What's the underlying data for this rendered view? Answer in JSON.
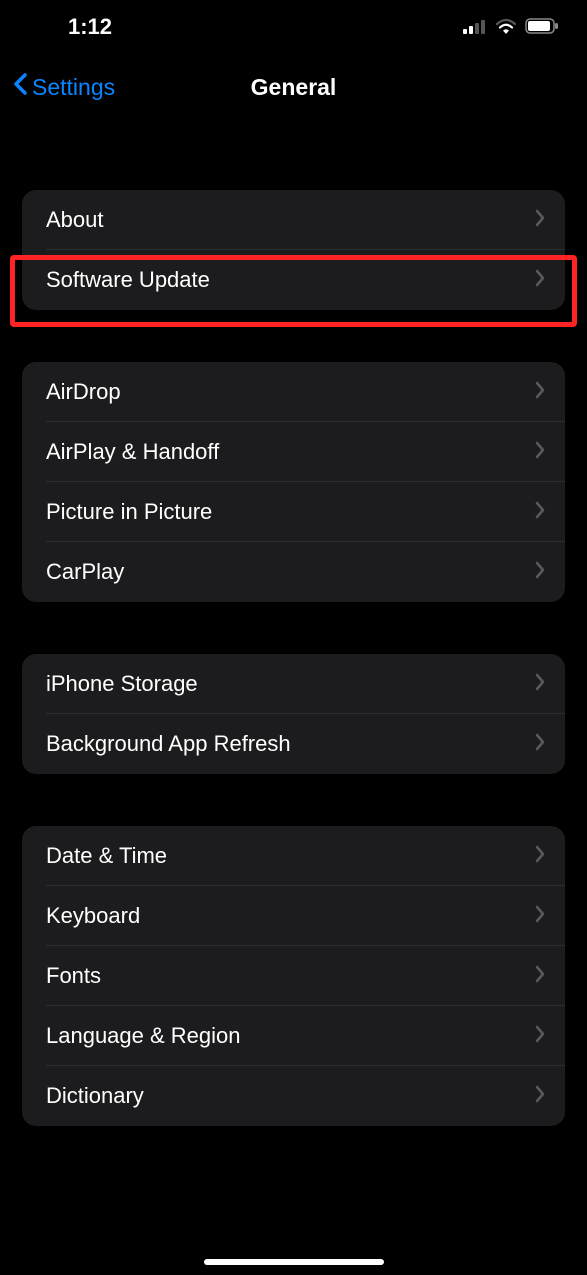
{
  "status": {
    "time": "1:12"
  },
  "nav": {
    "back_label": "Settings",
    "title": "General"
  },
  "groups": [
    {
      "rows": [
        {
          "label": "About",
          "name": "row-about"
        },
        {
          "label": "Software Update",
          "name": "row-software-update",
          "highlighted": true
        }
      ]
    },
    {
      "rows": [
        {
          "label": "AirDrop",
          "name": "row-airdrop"
        },
        {
          "label": "AirPlay & Handoff",
          "name": "row-airplay-handoff"
        },
        {
          "label": "Picture in Picture",
          "name": "row-picture-in-picture"
        },
        {
          "label": "CarPlay",
          "name": "row-carplay"
        }
      ]
    },
    {
      "rows": [
        {
          "label": "iPhone Storage",
          "name": "row-iphone-storage"
        },
        {
          "label": "Background App Refresh",
          "name": "row-background-app-refresh"
        }
      ]
    },
    {
      "rows": [
        {
          "label": "Date & Time",
          "name": "row-date-time"
        },
        {
          "label": "Keyboard",
          "name": "row-keyboard"
        },
        {
          "label": "Fonts",
          "name": "row-fonts"
        },
        {
          "label": "Language & Region",
          "name": "row-language-region"
        },
        {
          "label": "Dictionary",
          "name": "row-dictionary"
        }
      ]
    }
  ]
}
